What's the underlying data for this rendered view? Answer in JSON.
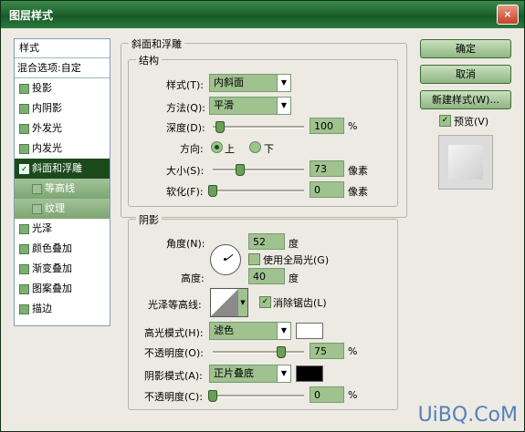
{
  "window": {
    "title": "图层样式",
    "close_label": "×"
  },
  "style_list": {
    "header": "样式",
    "blend_options": "混合选项:自定",
    "items": [
      {
        "label": "投影",
        "checked": false
      },
      {
        "label": "内阴影",
        "checked": false
      },
      {
        "label": "外发光",
        "checked": false
      },
      {
        "label": "内发光",
        "checked": false
      },
      {
        "label": "斜面和浮雕",
        "checked": true,
        "selected": true
      },
      {
        "label": "等高线",
        "checked": false,
        "sub": true
      },
      {
        "label": "纹理",
        "checked": false,
        "sub": true
      },
      {
        "label": "光泽",
        "checked": false
      },
      {
        "label": "颜色叠加",
        "checked": false
      },
      {
        "label": "渐变叠加",
        "checked": false
      },
      {
        "label": "图案叠加",
        "checked": false
      },
      {
        "label": "描边",
        "checked": false
      }
    ]
  },
  "bevel": {
    "section_title": "斜面和浮雕",
    "structure_title": "结构",
    "style_label": "样式(T):",
    "style_value": "内斜面",
    "technique_label": "方法(Q):",
    "technique_value": "平滑",
    "depth_label": "深度(D):",
    "depth_value": "100",
    "depth_unit": "%",
    "depth_slider": 0.08,
    "direction_label": "方向:",
    "dir_up": "上",
    "dir_down": "下",
    "size_label": "大小(S):",
    "size_value": "73",
    "size_unit": "像素",
    "size_slider": 0.3,
    "soften_label": "软化(F):",
    "soften_value": "0",
    "soften_unit": "像素",
    "soften_slider": 0.0
  },
  "shading": {
    "title": "阴影",
    "angle_label": "角度(N):",
    "angle_value": "52",
    "angle_unit": "度",
    "global_light_label": "使用全局光(G)",
    "altitude_label": "高度:",
    "altitude_value": "40",
    "altitude_unit": "度",
    "gloss_label": "光泽等高线:",
    "antialias_label": "消除锯齿(L)",
    "highlight_label": "高光模式(H):",
    "highlight_mode": "滤色",
    "highlight_color": "#ffffff",
    "hl_opacity_label": "不透明度(O):",
    "hl_opacity_value": "75",
    "hl_opacity_unit": "%",
    "hl_opacity_slider": 0.75,
    "shadow_label": "阴影模式(A):",
    "shadow_mode": "正片叠底",
    "shadow_color": "#000000",
    "sh_opacity_label": "不透明度(C):",
    "sh_opacity_value": "0",
    "sh_opacity_unit": "%",
    "sh_opacity_slider": 0.0
  },
  "buttons": {
    "ok": "确定",
    "cancel": "取消",
    "new_style": "新建样式(W)...",
    "preview": "预览(V)"
  },
  "watermark": "UiBQ.CoM"
}
